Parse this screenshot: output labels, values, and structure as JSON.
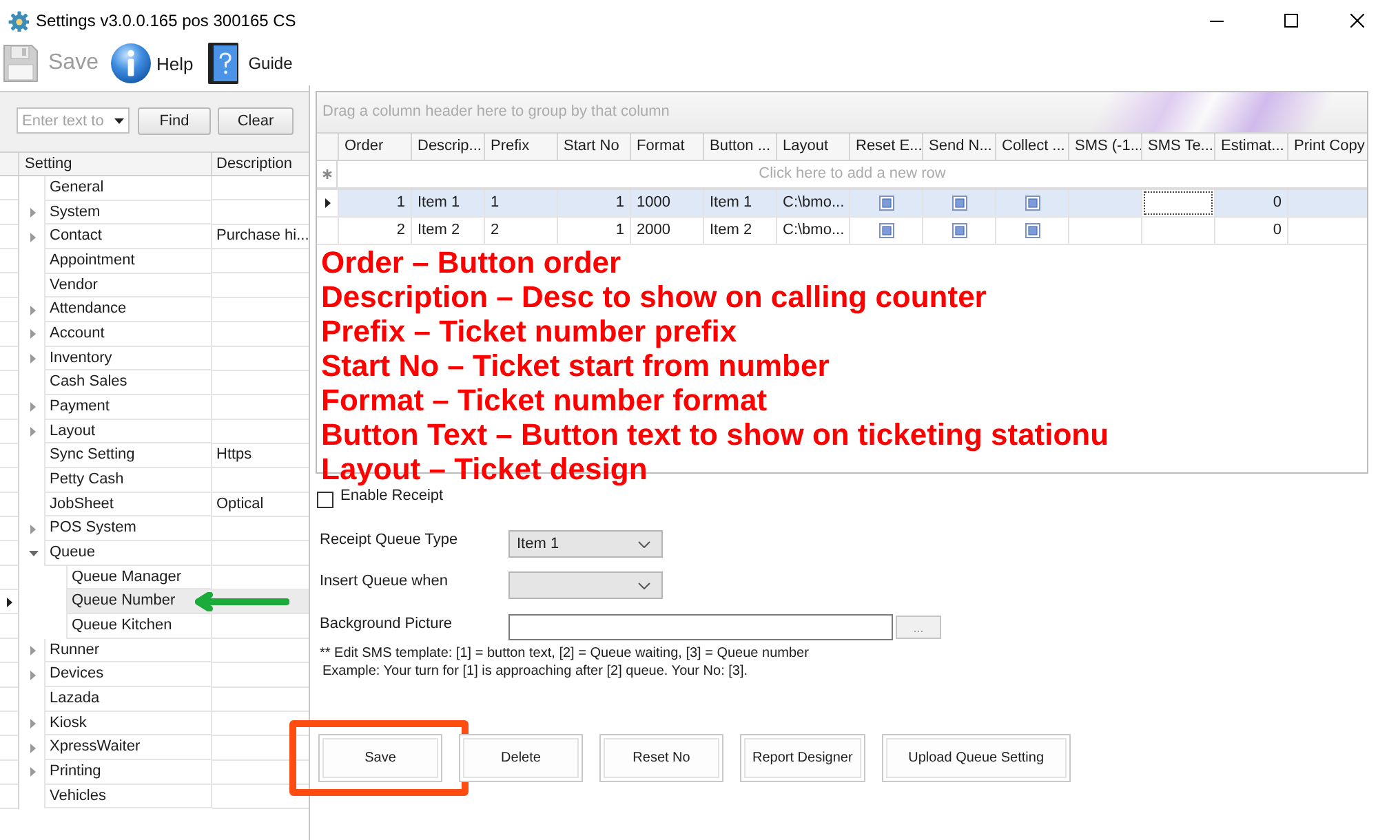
{
  "window": {
    "title": "Settings v3.0.0.165 pos 300165 CS"
  },
  "toolbar": [
    {
      "label": "Save",
      "kind": "floppy",
      "disabled": true
    },
    {
      "label": "Help",
      "kind": "info",
      "disabled": false
    },
    {
      "label": "Guide",
      "kind": "book",
      "disabled": false
    }
  ],
  "tree_search": {
    "placeholder": "Enter text to",
    "buttons": [
      "Find",
      "Clear"
    ]
  },
  "tree": {
    "columns": [
      "Setting",
      "Description"
    ],
    "items": [
      {
        "label": "General",
        "expandable": false,
        "selected": false
      },
      {
        "label": "System",
        "expandable": true,
        "expanded": false,
        "selected": false
      },
      {
        "label": "Contact",
        "description": "Purchase hi...",
        "expandable": true,
        "expanded": false,
        "selected": false
      },
      {
        "label": "Appointment",
        "expandable": false,
        "selected": false
      },
      {
        "label": "Vendor",
        "expandable": false,
        "selected": false
      },
      {
        "label": "Attendance",
        "expandable": true,
        "expanded": false,
        "selected": false
      },
      {
        "label": "Account",
        "expandable": true,
        "expanded": false,
        "selected": false
      },
      {
        "label": "Inventory",
        "expandable": true,
        "expanded": false,
        "selected": false
      },
      {
        "label": "Cash Sales",
        "expandable": false,
        "selected": false
      },
      {
        "label": "Payment",
        "expandable": true,
        "expanded": false,
        "selected": false
      },
      {
        "label": "Layout",
        "expandable": true,
        "expanded": false,
        "selected": false
      },
      {
        "label": "Sync Setting",
        "description": "Https",
        "expandable": false,
        "selected": false
      },
      {
        "label": "Petty Cash",
        "expandable": false,
        "selected": false
      },
      {
        "label": "JobSheet",
        "description": "Optical",
        "expandable": false,
        "selected": false
      },
      {
        "label": "POS System",
        "expandable": true,
        "expanded": false,
        "selected": false
      },
      {
        "label": "Queue",
        "expandable": true,
        "expanded": true,
        "selected": false,
        "children": [
          {
            "label": "Queue Manager",
            "expandable": false,
            "selected": false
          },
          {
            "label": "Queue Number",
            "expandable": false,
            "selected": true
          },
          {
            "label": "Queue Kitchen",
            "expandable": false,
            "selected": false
          }
        ]
      },
      {
        "label": "Runner",
        "expandable": true,
        "expanded": false,
        "selected": false
      },
      {
        "label": "Devices",
        "expandable": true,
        "expanded": false,
        "selected": false
      },
      {
        "label": "Lazada",
        "expandable": false,
        "selected": false
      },
      {
        "label": "Kiosk",
        "expandable": true,
        "expanded": false,
        "selected": false
      },
      {
        "label": "XpressWaiter",
        "expandable": true,
        "expanded": false,
        "selected": false
      },
      {
        "label": "Printing",
        "expandable": true,
        "expanded": false,
        "selected": false
      },
      {
        "label": "Vehicles",
        "expandable": false,
        "selected": false
      }
    ]
  },
  "grid": {
    "group_panel_hint": "Drag a column header here to group by that column",
    "columns": [
      "Order",
      "Descrip...",
      "Prefix",
      "Start No",
      "Format",
      "Button ...",
      "Layout",
      "Reset E...",
      "Send N...",
      "Collect ...",
      "SMS (-1...",
      "SMS Te...",
      "Estimat...",
      "Print Copy"
    ],
    "new_row_hint": "Click here to add a new row",
    "rows": [
      {
        "selected": true,
        "cells": [
          {
            "kind": "number",
            "text": "1"
          },
          {
            "kind": "text",
            "text": "Item 1"
          },
          {
            "kind": "text",
            "text": "1"
          },
          {
            "kind": "number",
            "text": "1"
          },
          {
            "kind": "text",
            "text": "1000"
          },
          {
            "kind": "text",
            "text": "Item 1"
          },
          {
            "kind": "text",
            "text": "C:\\bmo..."
          },
          {
            "kind": "check",
            "indeterminate": true
          },
          {
            "kind": "check",
            "indeterminate": true
          },
          {
            "kind": "check",
            "indeterminate": true
          },
          {
            "kind": "empty"
          },
          {
            "kind": "editor"
          },
          {
            "kind": "number",
            "text": "0"
          },
          {
            "kind": "empty"
          }
        ]
      },
      {
        "selected": false,
        "cells": [
          {
            "kind": "number",
            "text": "2"
          },
          {
            "kind": "text",
            "text": "Item 2"
          },
          {
            "kind": "text",
            "text": "2"
          },
          {
            "kind": "number",
            "text": "1"
          },
          {
            "kind": "text",
            "text": "2000"
          },
          {
            "kind": "text",
            "text": "Item 2"
          },
          {
            "kind": "text",
            "text": "C:\\bmo..."
          },
          {
            "kind": "check",
            "indeterminate": true
          },
          {
            "kind": "check",
            "indeterminate": true
          },
          {
            "kind": "check",
            "indeterminate": true
          },
          {
            "kind": "empty"
          },
          {
            "kind": "empty"
          },
          {
            "kind": "number",
            "text": "0"
          },
          {
            "kind": "empty"
          }
        ]
      }
    ]
  },
  "annotations": [
    "Order – Button order",
    "Description – Desc to show on calling counter",
    "Prefix – Ticket number prefix",
    "Start No – Ticket start from number",
    "Format – Ticket number format",
    "Button Text – Button text to show on ticketing stationu",
    "Layout – Ticket design"
  ],
  "form": {
    "enable_receipt": {
      "label": "Enable Receipt",
      "checked": false
    },
    "fields": [
      {
        "label": "Receipt Queue Type",
        "kind": "dropdown",
        "value": "Item 1"
      },
      {
        "label": "Insert Queue when",
        "kind": "dropdown"
      },
      {
        "label": "Background Picture",
        "kind": "file",
        "browse_button": "..."
      }
    ],
    "notes": [
      "** Edit SMS template: [1] = button text, [2] = Queue waiting, [3] = Queue number",
      "Example: Your turn for [1] is approaching after [2] queue. Your No: [3]."
    ]
  },
  "buttons": [
    {
      "label": "Save",
      "highlighted": true
    },
    {
      "label": "Delete",
      "highlighted": false
    },
    {
      "label": "Reset No",
      "highlighted": false
    },
    {
      "label": "Report Designer",
      "highlighted": false
    },
    {
      "label": "Upload Queue Setting",
      "highlighted": false
    }
  ]
}
